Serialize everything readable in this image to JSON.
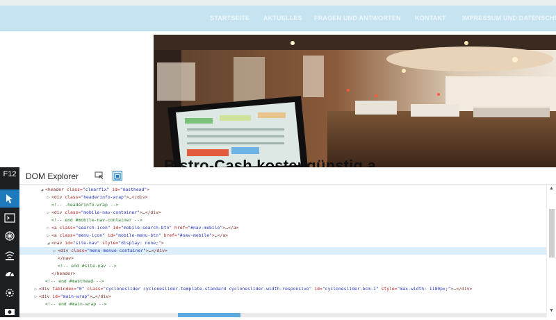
{
  "nav": {
    "items": [
      "STARTSEITE",
      "AKTUELLES",
      "FRAGEN UND ANTWORTEN",
      "KONTAKT",
      "IMPRESSUM UND DATENSCHU"
    ]
  },
  "hero": {
    "title": "Bistro-Cash kostengünstig a"
  },
  "devtools": {
    "f12": "F12",
    "title": "DOM Explorer",
    "dom_lines": [
      {
        "indent": 2,
        "twisty": "open",
        "parts": [
          [
            "tg",
            "<header "
          ],
          [
            "at",
            "class="
          ],
          [
            "av",
            "\"clearfix\""
          ],
          [
            "at",
            " id="
          ],
          [
            "av",
            "\"masthead\""
          ],
          [
            "tg",
            ">"
          ]
        ]
      },
      {
        "indent": 3,
        "twisty": "closed",
        "parts": [
          [
            "tg",
            "<div "
          ],
          [
            "at",
            "class="
          ],
          [
            "av",
            "\"headerinfo-wrap\""
          ],
          [
            "tg",
            ">"
          ],
          [
            "tx",
            "…"
          ],
          [
            "tg",
            "</div>"
          ]
        ]
      },
      {
        "indent": 3,
        "twisty": "",
        "parts": [
          [
            "cm",
            "<!-- .headerinfo-wrap -->"
          ]
        ]
      },
      {
        "indent": 3,
        "twisty": "closed",
        "parts": [
          [
            "tg",
            "<div "
          ],
          [
            "at",
            "class="
          ],
          [
            "av",
            "\"mobile-nav-container\""
          ],
          [
            "tg",
            ">"
          ],
          [
            "tx",
            "…"
          ],
          [
            "tg",
            "</div>"
          ]
        ]
      },
      {
        "indent": 3,
        "twisty": "",
        "parts": [
          [
            "cm",
            "<!-- end #mobile-nav-container -->"
          ]
        ]
      },
      {
        "indent": 3,
        "twisty": "closed",
        "parts": [
          [
            "tg",
            "<a "
          ],
          [
            "at",
            "class="
          ],
          [
            "av",
            "\"search-icon\""
          ],
          [
            "at",
            " id="
          ],
          [
            "av",
            "\"mobile-search-btn\""
          ],
          [
            "at",
            " href="
          ],
          [
            "av",
            "\"#nav-mobile\""
          ],
          [
            "tg",
            ">"
          ],
          [
            "tx",
            "…"
          ],
          [
            "tg",
            "</a>"
          ]
        ]
      },
      {
        "indent": 3,
        "twisty": "closed",
        "parts": [
          [
            "tg",
            "<a "
          ],
          [
            "at",
            "class="
          ],
          [
            "av",
            "\"menu-icon\""
          ],
          [
            "at",
            " id="
          ],
          [
            "av",
            "\"mobile-menu-btn\""
          ],
          [
            "at",
            " href="
          ],
          [
            "av",
            "\"#nav-mobile\""
          ],
          [
            "tg",
            ">"
          ],
          [
            "tx",
            "…"
          ],
          [
            "tg",
            "</a>"
          ]
        ]
      },
      {
        "indent": 3,
        "twisty": "open",
        "parts": [
          [
            "tg",
            "<nav "
          ],
          [
            "at",
            "id="
          ],
          [
            "av",
            "\"site-nav\""
          ],
          [
            "at",
            " style="
          ],
          [
            "av",
            "\"display: none;\""
          ],
          [
            "tg",
            ">"
          ]
        ]
      },
      {
        "indent": 4,
        "twisty": "closed",
        "selected": true,
        "parts": [
          [
            "tg",
            "<div "
          ],
          [
            "at",
            "class="
          ],
          [
            "av",
            "\"menu-menue-container\""
          ],
          [
            "tg",
            ">"
          ],
          [
            "tx",
            "…"
          ],
          [
            "tg",
            "</div>"
          ]
        ]
      },
      {
        "indent": 4,
        "twisty": "",
        "parts": [
          [
            "tg",
            "</nav>"
          ]
        ]
      },
      {
        "indent": 4,
        "twisty": "",
        "parts": [
          [
            "cm",
            "<!-- end #site-nav -->"
          ]
        ]
      },
      {
        "indent": 3,
        "twisty": "",
        "parts": [
          [
            "tg",
            "</header>"
          ]
        ]
      },
      {
        "indent": 2,
        "twisty": "",
        "parts": [
          [
            "cm",
            "<!-- end #masthead -->"
          ]
        ]
      },
      {
        "indent": 1,
        "twisty": "closed",
        "parts": [
          [
            "tg",
            "<div "
          ],
          [
            "at",
            "tabindex="
          ],
          [
            "av",
            "\"0\""
          ],
          [
            "at",
            " class="
          ],
          [
            "av",
            "\"cycloneslider cycloneslider-template-standard cycloneslider-width-responsive\""
          ],
          [
            "at",
            " id="
          ],
          [
            "av",
            "\"cycloneslider-bcm-1\""
          ],
          [
            "at",
            " style="
          ],
          [
            "av",
            "\"max-width: 1180px;\""
          ],
          [
            "tg",
            ">"
          ],
          [
            "tx",
            "…"
          ],
          [
            "tg",
            "</div>"
          ]
        ]
      },
      {
        "indent": 1,
        "twisty": "closed",
        "parts": [
          [
            "tg",
            "<div "
          ],
          [
            "at",
            "id="
          ],
          [
            "av",
            "\"main-wrap\""
          ],
          [
            "tg",
            ">"
          ],
          [
            "tx",
            "…"
          ],
          [
            "tg",
            "</div>"
          ]
        ]
      },
      {
        "indent": 2,
        "twisty": "",
        "parts": [
          [
            "cm",
            "<!-- end #main-wrap -->"
          ]
        ]
      }
    ]
  },
  "colors": {
    "nav_bg": "#c5e3f1",
    "devtools_sidebar": "#1c1f22",
    "active_tool": "#1f79bd",
    "selected_row": "#dceefb"
  }
}
